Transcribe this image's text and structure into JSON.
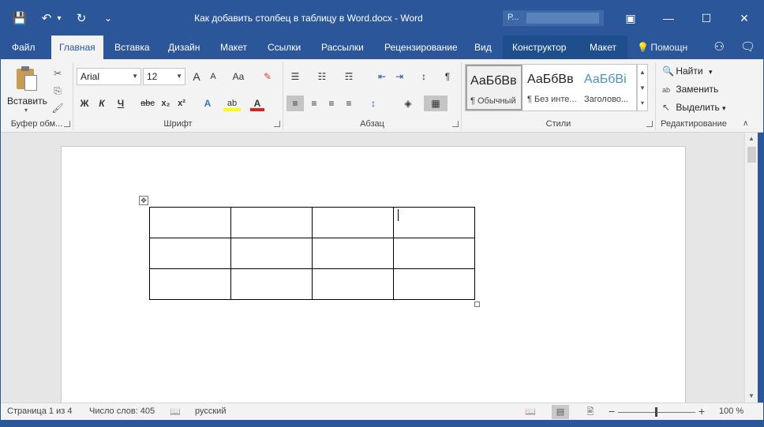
{
  "window": {
    "title": "Как добавить столбец в таблицу в Word.docx  -  Word",
    "account_initial": "Р...",
    "controls": {
      "ribbon_display": "▣",
      "minimize": "—",
      "maximize": "☐",
      "close": "✕"
    }
  },
  "qat": {
    "save_icon": "💾",
    "undo_icon": "↶",
    "undo_dd": "▾",
    "redo_icon": "↻",
    "customize": "⌄"
  },
  "tabs": [
    {
      "label": "Файл"
    },
    {
      "label": "Главная"
    },
    {
      "label": "Вставка"
    },
    {
      "label": "Дизайн"
    },
    {
      "label": "Макет"
    },
    {
      "label": "Ссылки"
    },
    {
      "label": "Рассылки"
    },
    {
      "label": "Рецензирование"
    },
    {
      "label": "Вид"
    },
    {
      "label": "Конструктор"
    },
    {
      "label": "Макет"
    }
  ],
  "tell_me": {
    "label": "Помощн",
    "icon": "💡"
  },
  "tab_icons": {
    "share": "⚇",
    "comments": "🗨"
  },
  "ribbon": {
    "clipboard": {
      "label": "Буфер обм...",
      "paste_label": "Вставить",
      "paste_arrow": "▾",
      "cut_icon": "✂",
      "copy_icon": "⎘",
      "format_painter_icon": "🖌"
    },
    "font": {
      "label": "Шрифт",
      "family": "Arial",
      "size": "12",
      "grow": "A",
      "shrink": "A",
      "case": "Aa",
      "clear": "✎",
      "bold": "Ж",
      "italic": "К",
      "underline": "Ч",
      "strike": "abc",
      "sub": "x₂",
      "sup": "x²",
      "effects": "A",
      "highlight": "ab",
      "color": "A"
    },
    "paragraph": {
      "label": "Абзац",
      "bullets": "☰",
      "numbering": "☷",
      "multilevel": "☶",
      "outdent": "⇤",
      "indent": "⇥",
      "sort": "↕",
      "pilcrow": "¶",
      "align_left": "≡",
      "align_center": "≡",
      "align_right": "≡",
      "justify": "≡",
      "spacing": "↕",
      "shading": "◈",
      "borders": "▦"
    },
    "styles": {
      "label": "Стили",
      "items": [
        {
          "sample": "АаБбВв",
          "name": "¶ Обычный"
        },
        {
          "sample": "АаБбВв",
          "name": "¶ Без инте..."
        },
        {
          "sample": "АаБбВі",
          "name": "Заголово..."
        }
      ],
      "scroll_up": "▲",
      "scroll_down": "▼",
      "more": "▾"
    },
    "editing": {
      "label": "Редактирование",
      "find": "Найти",
      "find_icon": "🔍",
      "find_dd": "▾",
      "replace": "Заменить",
      "replace_icon": "ab",
      "select": "Выделить",
      "select_icon": "↖",
      "select_dd": "▾",
      "collapse": "∧"
    }
  },
  "document": {
    "table": {
      "rows": 3,
      "cols": 4
    },
    "move_handle": "✥"
  },
  "scrollbar": {
    "up": "▲",
    "down": "▼"
  },
  "status": {
    "page": "Страница 1 из 4",
    "words": "Число слов: 405",
    "proof_icon": "📖",
    "language": "русский",
    "view_read": "📖",
    "view_print": "▤",
    "view_web": "🖹",
    "zoom_out": "−",
    "zoom_in": "+",
    "zoom": "100 %"
  }
}
